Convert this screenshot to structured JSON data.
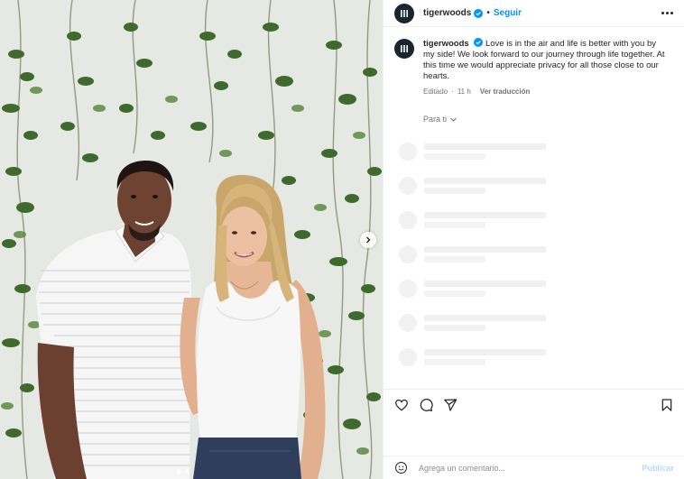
{
  "post": {
    "username": "tigerwoods",
    "separator": "•",
    "follow_label": "Seguir",
    "caption": "Love is in the air and life is better with you by my side! We look forward to our journey through life together. At this time we would appreciate privacy for all those close to our hearts.",
    "edited_label": "Editado",
    "time_sep": "·",
    "time_ago": "11 h",
    "translate_label": "Ver traducción",
    "for_you_label": "Para ti"
  },
  "comment": {
    "placeholder": "Agrega un comentario...",
    "publish_label": "Publicar"
  },
  "carousel": {
    "total_slides": 2,
    "active_index": 0
  },
  "icons": {
    "verified": "verified-badge-icon",
    "more": "more-options-icon",
    "like": "heart-icon",
    "comment": "comment-icon",
    "share": "send-icon",
    "save": "bookmark-icon",
    "emoji": "emoji-icon",
    "next": "chevron-right-icon"
  },
  "colors": {
    "accent": "#0095f6",
    "publish_disabled": "#b3dbff",
    "avatar_bg": "#1b2430",
    "text": "#262626",
    "muted": "#737373"
  }
}
